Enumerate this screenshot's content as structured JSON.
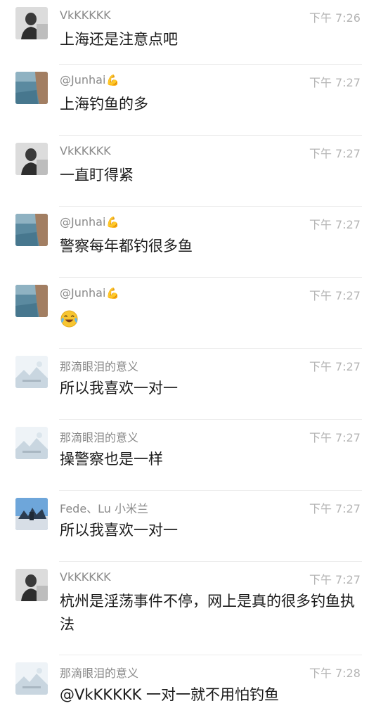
{
  "messages": [
    {
      "sender": "VkKKKKK",
      "time": "下午 7:26",
      "text": "上海还是注意点吧",
      "avatar": "vk",
      "emoji": ""
    },
    {
      "sender": "@Junhai",
      "badge": "💪",
      "time": "下午 7:27",
      "text": "上海钓鱼的多",
      "avatar": "junhai",
      "emoji": ""
    },
    {
      "sender": "VkKKKKK",
      "time": "下午 7:27",
      "text": "一直盯得紧",
      "avatar": "vk",
      "emoji": ""
    },
    {
      "sender": "@Junhai",
      "badge": "💪",
      "time": "下午 7:27",
      "text": "警察每年都钓很多鱼",
      "avatar": "junhai",
      "emoji": ""
    },
    {
      "sender": "@Junhai",
      "badge": "💪",
      "time": "下午 7:27",
      "text": "",
      "avatar": "junhai",
      "emoji": "laughing-crying-emoji"
    },
    {
      "sender": "那滴眼泪的意义",
      "time": "下午 7:27",
      "text": "所以我喜欢一对一",
      "avatar": "lake",
      "emoji": ""
    },
    {
      "sender": "那滴眼泪的意义",
      "time": "下午 7:27",
      "text": "操警察也是一样",
      "avatar": "lake",
      "emoji": ""
    },
    {
      "sender": "Fede、Lu 小米兰",
      "time": "下午 7:27",
      "text": "所以我喜欢一对一",
      "avatar": "fede",
      "emoji": ""
    },
    {
      "sender": "VkKKKKK",
      "time": "下午 7:27",
      "text": "杭州是淫荡事件不停，网上是真的很多钓鱼执法",
      "avatar": "vk",
      "emoji": ""
    },
    {
      "sender": "那滴眼泪的意义",
      "time": "下午 7:28",
      "text": "@VkKKKKK 一对一就不用怕钓鱼",
      "avatar": "lake",
      "emoji": ""
    }
  ],
  "colors": {
    "sender": "#8a8a8a",
    "time": "#b5b5b5",
    "text": "#1b1b1b",
    "divider": "#ececec"
  }
}
